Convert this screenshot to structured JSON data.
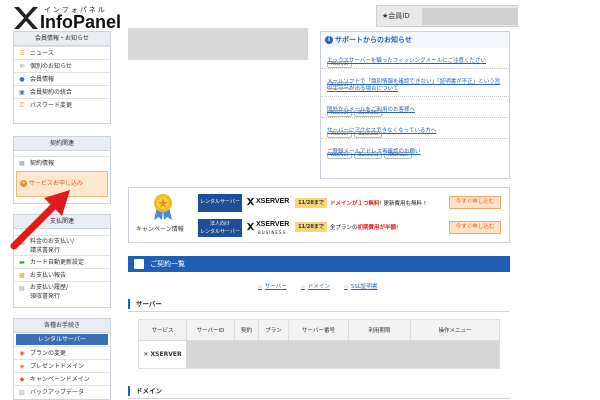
{
  "header": {
    "logo_kana": "インフォパネル",
    "logo_text": "InfoPanel",
    "member_id_label": "★会員ID"
  },
  "sidebar": {
    "member_box": {
      "title": "会員情報・お知らせ",
      "items": [
        {
          "label": "ニュース",
          "icon": "news-icon"
        },
        {
          "label": "個別のお知らせ",
          "icon": "mail-icon"
        },
        {
          "label": "会員情報",
          "icon": "user-icon"
        },
        {
          "label": "会員契約の統合",
          "icon": "merge-icon"
        },
        {
          "label": "パスワード変更",
          "icon": "key-icon"
        }
      ]
    },
    "contract_box": {
      "title": "契約関連",
      "items": [
        {
          "label": "契約情報",
          "icon": "document-icon"
        }
      ],
      "apply_button": "サービスお申し込み"
    },
    "payment_box": {
      "title": "支払関連",
      "items": [
        {
          "label": "料金のお支払い/\n請求書発行",
          "icon": "yen-icon"
        },
        {
          "label": "カード自動更新設定",
          "icon": "card-icon"
        },
        {
          "label": "お支払い報告",
          "icon": "report-icon"
        },
        {
          "label": "お支払い履歴/\n領収書発行",
          "icon": "receipt-icon"
        }
      ]
    },
    "procedures_box": {
      "title": "各種お手続き",
      "subhead": "レンタルサーバー",
      "items": [
        {
          "label": "プランの変更",
          "icon": "plan-icon"
        },
        {
          "label": "プレゼントドメイン",
          "icon": "gift-icon"
        },
        {
          "label": "キャンペーンドメイン",
          "icon": "campaign-icon"
        },
        {
          "label": "バックアップデータ",
          "icon": "backup-icon"
        }
      ]
    }
  },
  "notice": {
    "title": "サポートからのお知らせ",
    "items": [
      {
        "tags": [
          "Xserver"
        ],
        "text": "エックスサーバーを騙ったフィッシングメールにご注意ください"
      },
      {
        "tags": [
          "Xserver"
        ],
        "text": "メールソフトで「識別情報を確認できない」「証明書が不正」という旨のエラーが出る場合について"
      },
      {
        "tags": [
          "Xserver",
          "Business"
        ],
        "text": "国外からメールをご利用のお客様へ"
      },
      {
        "tags": [
          "Xserver",
          "Business"
        ],
        "text": "サーバーにアクセスできなくなっている方へ"
      },
      {
        "tags": [
          "Xserver",
          "Business",
          "Xdomain"
        ],
        "text": "ご登録メールアドレス再確認のお願い"
      }
    ]
  },
  "campaign": {
    "label": "キャンペーン情報",
    "rows": [
      {
        "tag": "レンタルサーバー",
        "logo": "XSERVER",
        "logo_sub": "",
        "date": "11/28まで",
        "text_pre": "",
        "text_red": "ドメインが１つ無料",
        "text_post": "! 更新費用も無料 !",
        "button": "今すぐ申し込む"
      },
      {
        "tag": "法人向け\nレンタルサーバー",
        "logo": "XSERVER",
        "logo_sub": "BUSINESS",
        "date": "11/28まで",
        "text_pre": "全プランの",
        "text_red": "初期費用が半額",
        "text_post": "!",
        "button": "今すぐ申し込む"
      }
    ]
  },
  "contracts": {
    "title": "ご契約一覧",
    "anchors": [
      "サーバー",
      "ドメイン",
      "SSL証明書"
    ],
    "server_section": "サーバー",
    "columns": [
      "サービス",
      "サーバーID",
      "契約",
      "プラン",
      "サーバー番号",
      "利用期限",
      "操作メニュー"
    ],
    "row_service": "XSERVER",
    "domain_section": "ドメイン"
  },
  "colors": {
    "accent_blue": "#1f5fb4",
    "annotation_red": "#e01b1b",
    "apply_orange": "#f08a24"
  }
}
